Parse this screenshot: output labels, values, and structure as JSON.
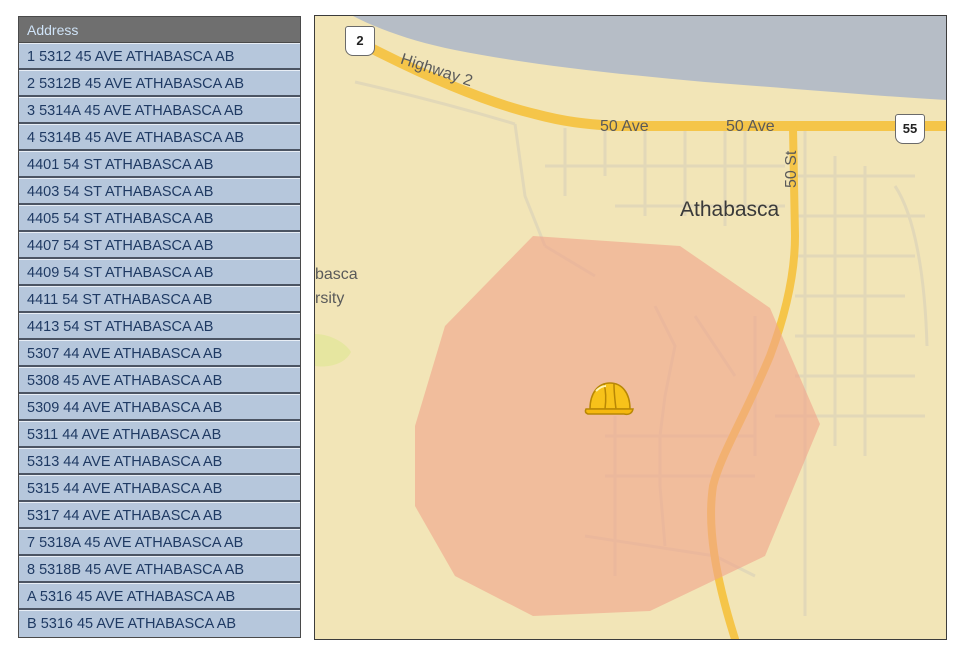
{
  "table": {
    "header": "Address",
    "rows": [
      "1 5312 45 AVE ATHABASCA AB",
      "2 5312B 45 AVE ATHABASCA AB",
      "3 5314A 45 AVE ATHABASCA AB",
      "4 5314B 45 AVE ATHABASCA AB",
      "4401 54 ST ATHABASCA AB",
      "4403 54 ST ATHABASCA AB",
      "4405 54 ST ATHABASCA AB",
      "4407 54 ST ATHABASCA AB",
      "4409 54 ST ATHABASCA AB",
      "4411 54 ST ATHABASCA AB",
      "4413 54 ST ATHABASCA AB",
      "5307 44 AVE ATHABASCA AB",
      "5308 45 AVE ATHABASCA AB",
      "5309 44 AVE ATHABASCA AB",
      "5311 44 AVE ATHABASCA AB",
      "5313 44 AVE ATHABASCA AB",
      "5315 44 AVE ATHABASCA AB",
      "5317 44 AVE ATHABASCA AB",
      "7 5318A 45 AVE ATHABASCA AB",
      "8 5318B 45 AVE ATHABASCA AB",
      "A 5316 45 AVE ATHABASCA AB",
      "B 5316 45 AVE ATHABASCA AB"
    ]
  },
  "map": {
    "city": "Athabasca",
    "roads": {
      "highway2": "Highway 2",
      "ave50_a": "50 Ave",
      "ave50_b": "50 Ave",
      "st50": "50 St"
    },
    "shields": {
      "left": "2",
      "right": "55"
    },
    "partial_labels": {
      "line1": "basca",
      "line2": "rsity"
    },
    "marker_icon": "hard-hat-icon",
    "colors": {
      "land": "#f2e5b7",
      "water": "#b6bdc6",
      "highway": "#f5c549",
      "street": "#e2d8b8",
      "zone": "#f0a58a"
    }
  }
}
